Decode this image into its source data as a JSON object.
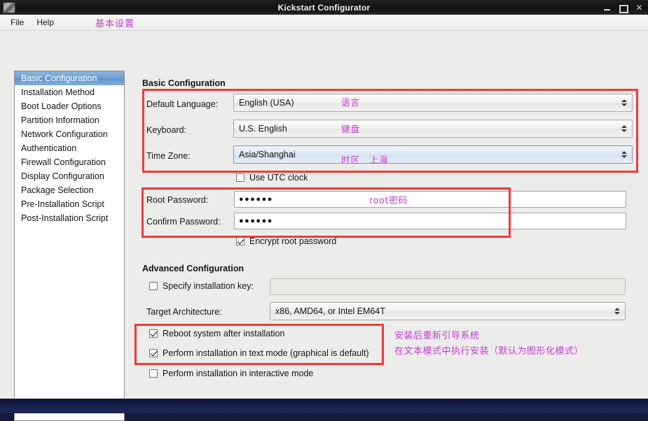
{
  "window": {
    "title": "Kickstart Configurator",
    "icon": "app-icon",
    "buttons": {
      "minimize": "minimize-icon",
      "maximize": "maximize-icon",
      "close": "✕"
    }
  },
  "menubar": {
    "items": [
      {
        "label": "File"
      },
      {
        "label": "Help"
      }
    ],
    "annotation": "基本设置"
  },
  "sidebar": {
    "items": [
      {
        "label": "Basic Configuration",
        "selected": true
      },
      {
        "label": "Installation Method",
        "selected": false
      },
      {
        "label": "Boot Loader Options",
        "selected": false
      },
      {
        "label": "Partition Information",
        "selected": false
      },
      {
        "label": "Network Configuration",
        "selected": false
      },
      {
        "label": "Authentication",
        "selected": false
      },
      {
        "label": "Firewall Configuration",
        "selected": false
      },
      {
        "label": "Display Configuration",
        "selected": false
      },
      {
        "label": "Package Selection",
        "selected": false
      },
      {
        "label": "Pre-Installation Script",
        "selected": false
      },
      {
        "label": "Post-Installation Script",
        "selected": false
      }
    ]
  },
  "basic": {
    "heading": "Basic Configuration",
    "default_language": {
      "label": "Default Language:",
      "value": "English (USA)",
      "annotation": "语言"
    },
    "keyboard": {
      "label": "Keyboard:",
      "value": "U.S. English",
      "annotation": "键盘"
    },
    "timezone": {
      "label": "Time Zone:",
      "value": "Asia/Shanghai",
      "annotation": "时区　上海"
    },
    "use_utc": {
      "label": "Use UTC clock",
      "checked": false
    },
    "root_password": {
      "label": "Root Password:",
      "value": "●●●●●●",
      "annotation": "root密码"
    },
    "confirm_password": {
      "label": "Confirm Password:",
      "value": "●●●●●●"
    },
    "encrypt_root": {
      "label": "Encrypt root password",
      "checked": true
    }
  },
  "advanced": {
    "heading": "Advanced Configuration",
    "install_key": {
      "label": "Specify installation key:",
      "checked": false,
      "value": ""
    },
    "target_arch": {
      "label": "Target Architecture:",
      "value": "x86, AMD64, or Intel EM64T"
    },
    "reboot": {
      "label": "Reboot system after installation",
      "checked": true,
      "annotation": "安装后重新引导系统"
    },
    "text_mode": {
      "label": "Perform installation in text mode (graphical is default)",
      "checked": true,
      "annotation": "在文本模式中执行安装（默认为图形化模式）"
    },
    "interactive_mode": {
      "label": "Perform installation in interactive mode",
      "checked": false
    }
  },
  "colors": {
    "annotation": "#c03fd0",
    "highlight_box": "#ef3b3b",
    "selection": "#6ea0d2",
    "titlebar": "#141414",
    "desktop": "#16204a"
  }
}
